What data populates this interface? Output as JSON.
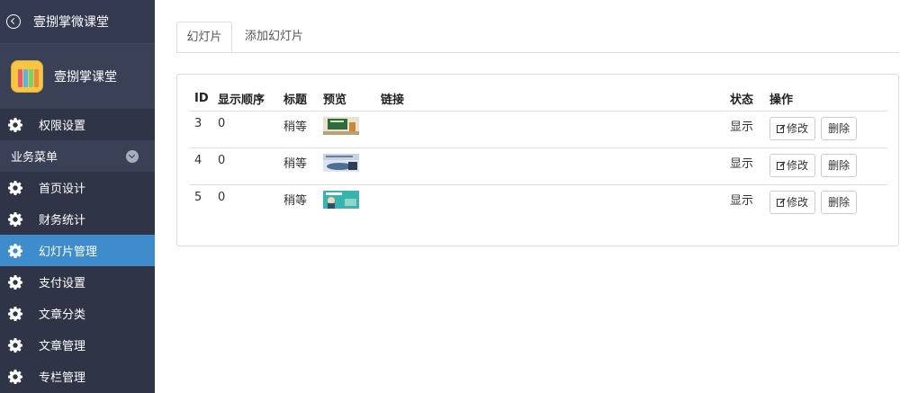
{
  "sidebar": {
    "top_title": "壹捌掌微课堂",
    "brand_name": "壹捌掌课堂",
    "items": [
      {
        "label": "权限设置",
        "icon": "gear-icon"
      },
      {
        "label": "业务菜单",
        "icon": "chevron-down-icon"
      },
      {
        "label": "首页设计",
        "icon": "gear-icon"
      },
      {
        "label": "财务统计",
        "icon": "gear-icon"
      },
      {
        "label": "幻灯片管理",
        "icon": "gear-icon",
        "active": true
      },
      {
        "label": "支付设置",
        "icon": "gear-icon"
      },
      {
        "label": "文章分类",
        "icon": "gear-icon"
      },
      {
        "label": "文章管理",
        "icon": "gear-icon"
      },
      {
        "label": "专栏管理",
        "icon": "gear-icon"
      }
    ]
  },
  "tabs": [
    {
      "label": "幻灯片"
    },
    {
      "label": "添加幻灯片"
    }
  ],
  "table": {
    "headers": [
      "ID",
      "显示顺序",
      "标题",
      "预览",
      "链接",
      "状态",
      "操作"
    ],
    "rows": [
      {
        "id": "3",
        "order": "0",
        "title": "稍等",
        "link": "",
        "status": "显示",
        "edit": "修改",
        "delete": "删除"
      },
      {
        "id": "4",
        "order": "0",
        "title": "稍等",
        "link": "",
        "status": "显示",
        "edit": "修改",
        "delete": "删除"
      },
      {
        "id": "5",
        "order": "0",
        "title": "稍等",
        "link": "",
        "status": "显示",
        "edit": "修改",
        "delete": "删除"
      }
    ]
  },
  "colors": {
    "sidebar_bg": "#2f3447",
    "active_item": "#3e8ccc",
    "logo_bg": "#f7c645"
  }
}
